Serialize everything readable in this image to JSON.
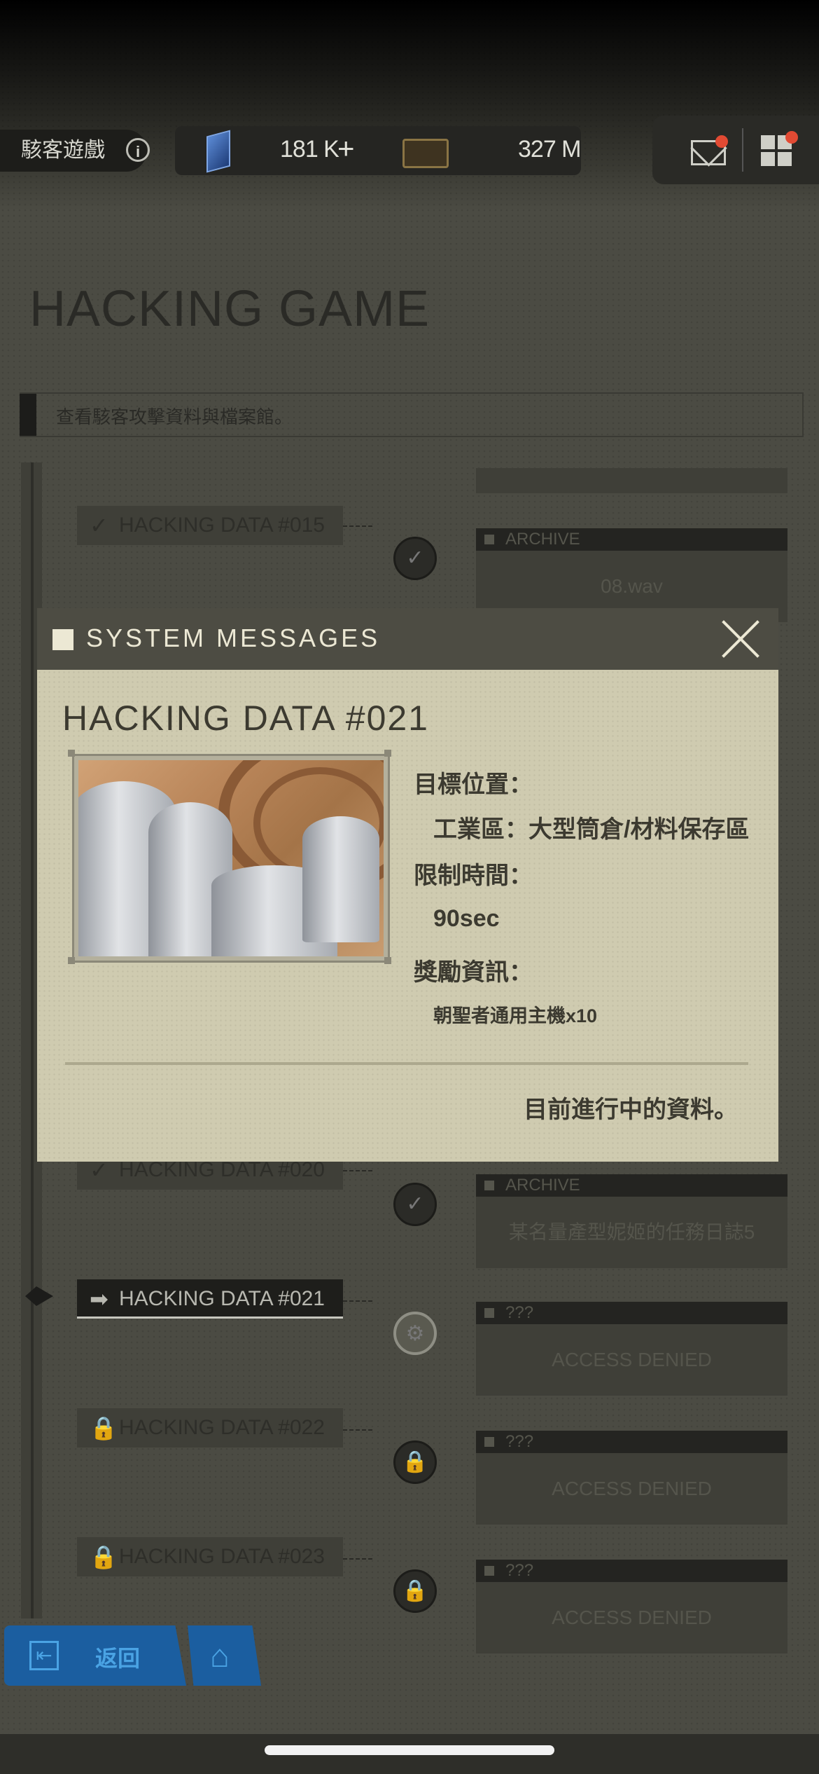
{
  "topbar": {
    "title": "駭客遊戲",
    "gem_value": "181 K",
    "chip_value": "327 M"
  },
  "page": {
    "title": "HACKING GAME",
    "subtitle": "查看駭客攻擊資料與檔案館。"
  },
  "list": [
    {
      "label": "HACKING DATA #015",
      "state": "done",
      "card_head": "ARCHIVE",
      "card_body": "08.wav"
    },
    {
      "label": "HACKING DATA #020",
      "state": "done",
      "card_head": "ARCHIVE",
      "card_body": "某名量產型妮姬的任務日誌5"
    },
    {
      "label": "HACKING DATA #021",
      "state": "current",
      "card_head": "???",
      "card_body": "ACCESS DENIED"
    },
    {
      "label": "HACKING DATA #022",
      "state": "locked",
      "card_head": "???",
      "card_body": "ACCESS DENIED"
    },
    {
      "label": "HACKING DATA #023",
      "state": "locked",
      "card_head": "???",
      "card_body": "ACCESS DENIED"
    }
  ],
  "modal": {
    "header": "SYSTEM MESSAGES",
    "data_title": "HACKING DATA #021",
    "location_label": "目標位置：",
    "location_value": "工業區：大型筒倉/材料保存區",
    "time_label": "限制時間：",
    "time_value": "90sec",
    "reward_label": "獎勵資訊：",
    "reward_value": "朝聖者通用主機x10",
    "status": "目前進行中的資料。"
  },
  "nav": {
    "back_label": "返回"
  }
}
